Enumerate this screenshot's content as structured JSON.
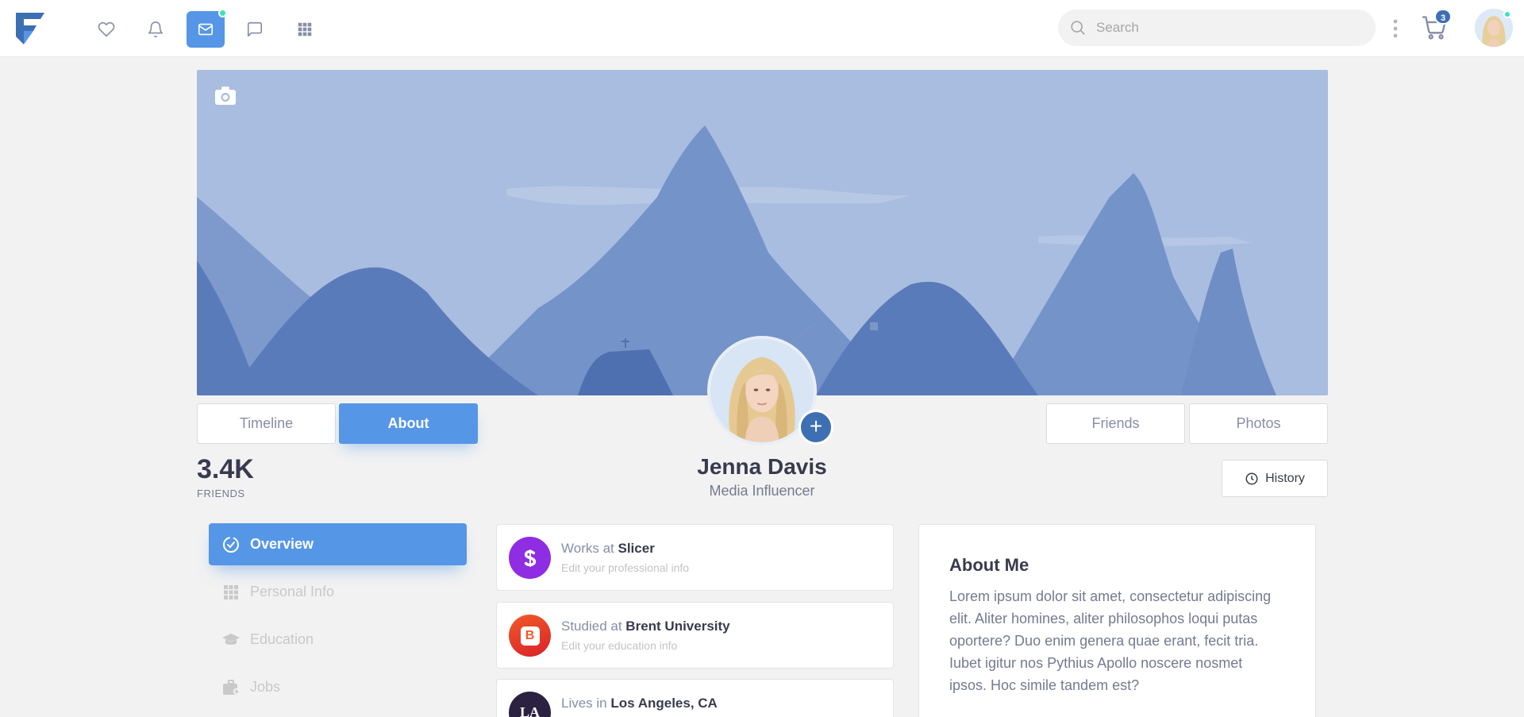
{
  "nav": {
    "icons": [
      "heart-icon",
      "bell-icon",
      "mail-icon",
      "chat-icon",
      "apps-icon"
    ],
    "search_placeholder": "Search",
    "cart_count": "3",
    "colors": {
      "accent": "#5596e6",
      "brand": "#3d70b2",
      "online": "#3ce0c4"
    }
  },
  "profile": {
    "tabs": {
      "timeline": "Timeline",
      "about": "About",
      "friends": "Friends",
      "photos": "Photos"
    },
    "friends_count": "3.4K",
    "friends_label": "FRIENDS",
    "name": "Jenna Davis",
    "role": "Media Influencer",
    "history": "History"
  },
  "menu": {
    "items": [
      {
        "label": "Overview",
        "icon": "check-circle-icon",
        "active": true
      },
      {
        "label": "Personal Info",
        "icon": "grid-icon"
      },
      {
        "label": "Education",
        "icon": "graduation-cap-icon"
      },
      {
        "label": "Jobs",
        "icon": "briefcase-icon"
      }
    ]
  },
  "info": [
    {
      "prefix": "Works at",
      "value": "Slicer",
      "sub": "Edit your professional info",
      "icon_label": "S",
      "color": "#8e2de2"
    },
    {
      "prefix": "Studied at",
      "value": "Brent University",
      "sub": "Edit your education info",
      "icon_label": "B",
      "color": "#f05a28"
    },
    {
      "prefix": "Lives in",
      "value": "Los Angeles, CA",
      "sub": "",
      "icon_label": "LA",
      "color": "#2b2140"
    }
  ],
  "about": {
    "title": "About Me",
    "text": "Lorem ipsum dolor sit amet, consectetur adipiscing elit. Aliter homines, aliter philosophos loqui putas oportere? Duo enim genera quae erant, fecit tria. Iubet igitur nos Pythius Apollo noscere nosmet ipsos. Hoc simile tandem est?"
  }
}
